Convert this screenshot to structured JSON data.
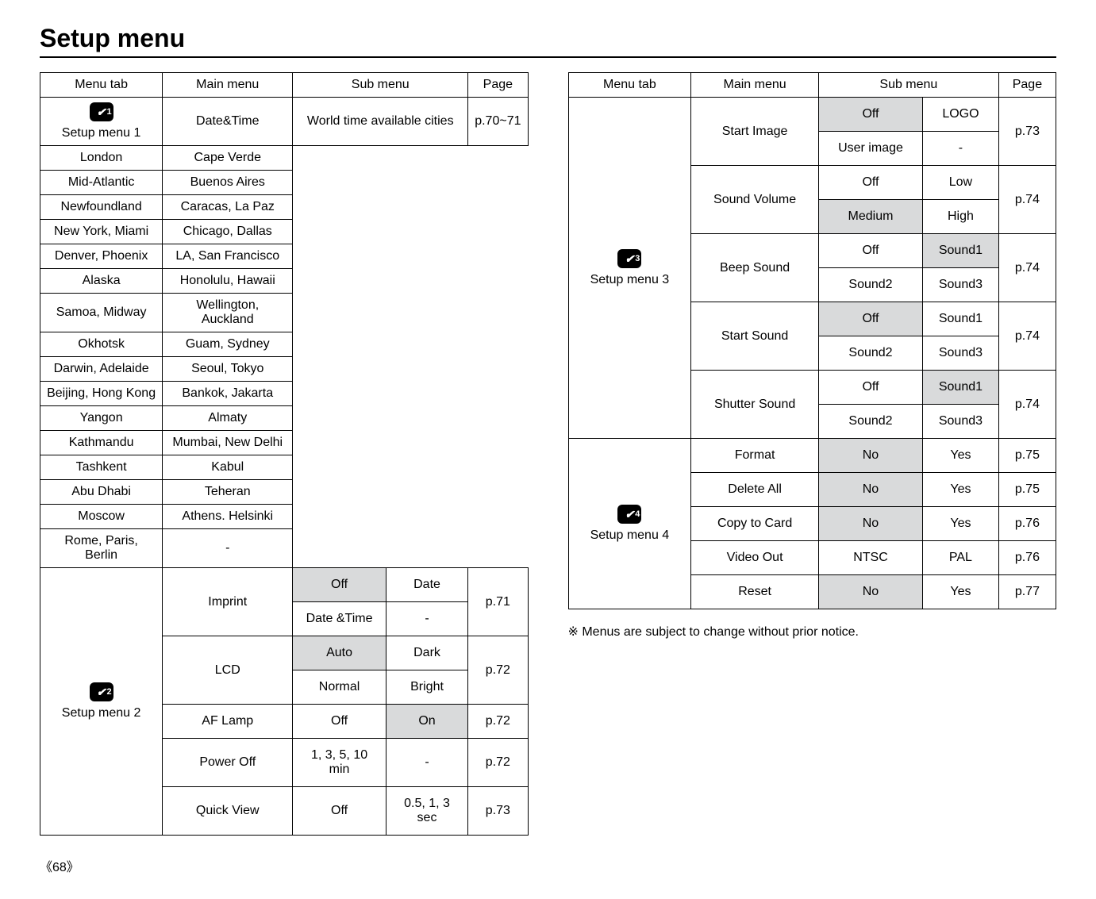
{
  "title": "Setup menu",
  "headers": {
    "menu_tab": "Menu tab",
    "main_menu": "Main menu",
    "sub_menu": "Sub menu",
    "page": "Page"
  },
  "setup1": {
    "tab_label": "Setup menu 1",
    "main": "Date&Time",
    "world_label": "World time available cities",
    "cities": [
      [
        "London",
        "Cape Verde"
      ],
      [
        "Mid-Atlantic",
        "Buenos Aires"
      ],
      [
        "Newfoundland",
        "Caracas, La Paz"
      ],
      [
        "New York, Miami",
        "Chicago, Dallas"
      ],
      [
        "Denver, Phoenix",
        "LA, San Francisco"
      ],
      [
        "Alaska",
        "Honolulu, Hawaii"
      ],
      [
        "Samoa, Midway",
        "Wellington, Auckland"
      ],
      [
        "Okhotsk",
        "Guam, Sydney"
      ],
      [
        "Darwin, Adelaide",
        "Seoul, Tokyo"
      ],
      [
        "Beijing, Hong Kong",
        "Bankok, Jakarta"
      ],
      [
        "Yangon",
        "Almaty"
      ],
      [
        "Kathmandu",
        "Mumbai, New Delhi"
      ],
      [
        "Tashkent",
        "Kabul"
      ],
      [
        "Abu Dhabi",
        "Teheran"
      ],
      [
        "Moscow",
        "Athens. Helsinki"
      ],
      [
        "Rome, Paris, Berlin",
        "-"
      ]
    ],
    "page": "p.70~71"
  },
  "setup2": {
    "tab_label": "Setup menu 2",
    "items": [
      {
        "main": "Imprint",
        "r1": [
          "Off",
          "Date"
        ],
        "r2": [
          "Date &Time",
          "-"
        ],
        "page": "p.71",
        "shade": [
          0
        ]
      },
      {
        "main": "LCD",
        "r1": [
          "Auto",
          "Dark"
        ],
        "r2": [
          "Normal",
          "Bright"
        ],
        "page": "p.72",
        "shade": [
          0
        ]
      },
      {
        "main": "AF Lamp",
        "r1": [
          "Off",
          "On"
        ],
        "page": "p.72",
        "shade": [
          1
        ]
      },
      {
        "main": "Power Off",
        "r1": [
          "1, 3, 5, 10 min",
          "-"
        ],
        "page": "p.72",
        "shade": []
      },
      {
        "main": "Quick View",
        "r1": [
          "Off",
          "0.5, 1, 3 sec"
        ],
        "page": "p.73",
        "shade": []
      }
    ]
  },
  "setup3": {
    "tab_label": "Setup menu 3",
    "items": [
      {
        "main": "Start Image",
        "r1": [
          "Off",
          "LOGO"
        ],
        "r2": [
          "User image",
          "-"
        ],
        "page": "p.73",
        "shade1": [
          0
        ],
        "shade2": []
      },
      {
        "main": "Sound Volume",
        "r1": [
          "Off",
          "Low"
        ],
        "r2": [
          "Medium",
          "High"
        ],
        "page": "p.74",
        "shade1": [],
        "shade2": [
          0
        ]
      },
      {
        "main": "Beep Sound",
        "r1": [
          "Off",
          "Sound1"
        ],
        "r2": [
          "Sound2",
          "Sound3"
        ],
        "page": "p.74",
        "shade1": [
          1
        ],
        "shade2": []
      },
      {
        "main": "Start Sound",
        "r1": [
          "Off",
          "Sound1"
        ],
        "r2": [
          "Sound2",
          "Sound3"
        ],
        "page": "p.74",
        "shade1": [
          0
        ],
        "shade2": []
      },
      {
        "main": "Shutter Sound",
        "r1": [
          "Off",
          "Sound1"
        ],
        "r2": [
          "Sound2",
          "Sound3"
        ],
        "page": "p.74",
        "shade1": [
          1
        ],
        "shade2": []
      }
    ]
  },
  "setup4": {
    "tab_label": "Setup menu 4",
    "items": [
      {
        "main": "Format",
        "sub": [
          "No",
          "Yes"
        ],
        "page": "p.75",
        "shade": [
          0
        ]
      },
      {
        "main": "Delete All",
        "sub": [
          "No",
          "Yes"
        ],
        "page": "p.75",
        "shade": [
          0
        ]
      },
      {
        "main": "Copy to Card",
        "sub": [
          "No",
          "Yes"
        ],
        "page": "p.76",
        "shade": [
          0
        ]
      },
      {
        "main": "Video Out",
        "sub": [
          "NTSC",
          "PAL"
        ],
        "page": "p.76",
        "shade": []
      },
      {
        "main": "Reset",
        "sub": [
          "No",
          "Yes"
        ],
        "page": "p.77",
        "shade": [
          0
        ]
      }
    ]
  },
  "note": "※ Menus are subject to change without prior notice.",
  "page_number": "《68》"
}
